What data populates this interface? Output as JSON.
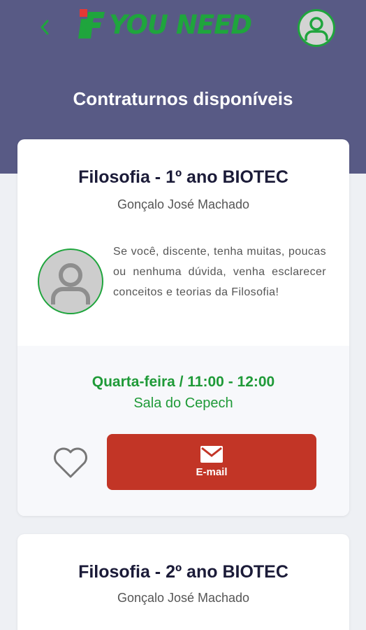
{
  "header": {
    "back_icon": "chevron-left-icon",
    "logo_text": "YOU NEED",
    "profile_icon": "user-icon",
    "brand_color": "#1fa53d",
    "header_color": "#585a85"
  },
  "page": {
    "title": "Contraturnos disponíveis"
  },
  "cards": [
    {
      "title": "Filosofia - 1º ano BIOTEC",
      "teacher": "Gonçalo José Machado",
      "description": "Se você, discente, tenha muitas, poucas ou nenhuma dúvida, venha esclarecer conceitos e teorias da Filosofia!",
      "schedule": "Quarta-feira / 11:00 - 12:00",
      "room": "Sala do Cepech",
      "favorite_icon": "heart-outline-icon",
      "email_icon": "mail-icon",
      "email_label": "E-mail",
      "email_color": "#c23526"
    },
    {
      "title": "Filosofia - 2º ano BIOTEC",
      "teacher": "Gonçalo José Machado"
    }
  ]
}
